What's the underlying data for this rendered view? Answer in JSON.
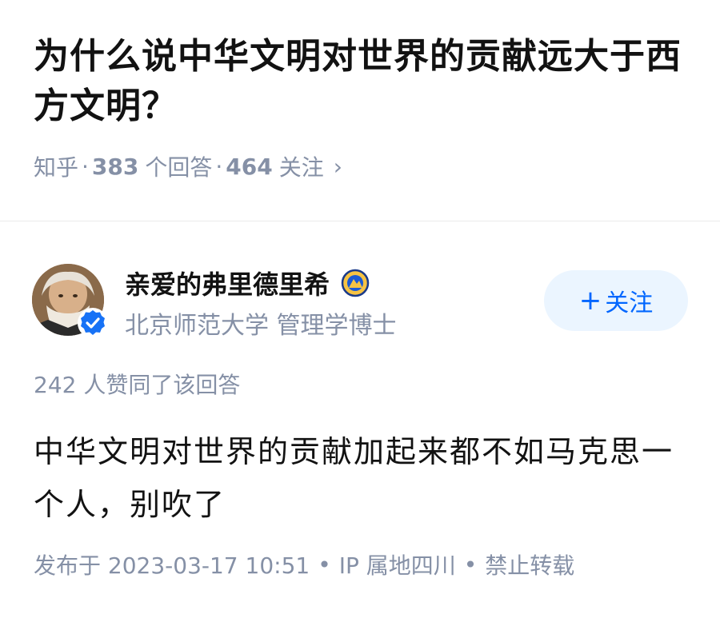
{
  "question": {
    "title": "为什么说中华文明对世界的贡献远大于西方文明？",
    "meta": {
      "source": "知乎",
      "answers_count": "383",
      "answers_label": "个回答",
      "followers_count": "464",
      "followers_label": "关注",
      "chevron": "›"
    }
  },
  "author": {
    "name": "亲爱的弗里德里希",
    "headline": "北京师范大学 管理学博士",
    "avatar_icon": "avatar-portrait",
    "verified_icon": "verified-check-icon",
    "name_badge_icon": "creator-badge-icon",
    "follow_button": {
      "plus": "+",
      "label": "关注"
    }
  },
  "answer": {
    "votes_text": "242 人赞同了该回答",
    "content": "中华文明对世界的贡献加起来都不如马克思一个人，别吹了",
    "meta": {
      "published": "发布于 2023-03-17 10:51",
      "ip": "IP 属地四川",
      "copyright": "禁止转载",
      "separator": "•"
    }
  },
  "colors": {
    "accent": "#0066ff",
    "follow_bg": "#ebf5ff",
    "meta_text": "#8590a6",
    "primary_text": "#121212",
    "divider": "#ebebeb"
  }
}
